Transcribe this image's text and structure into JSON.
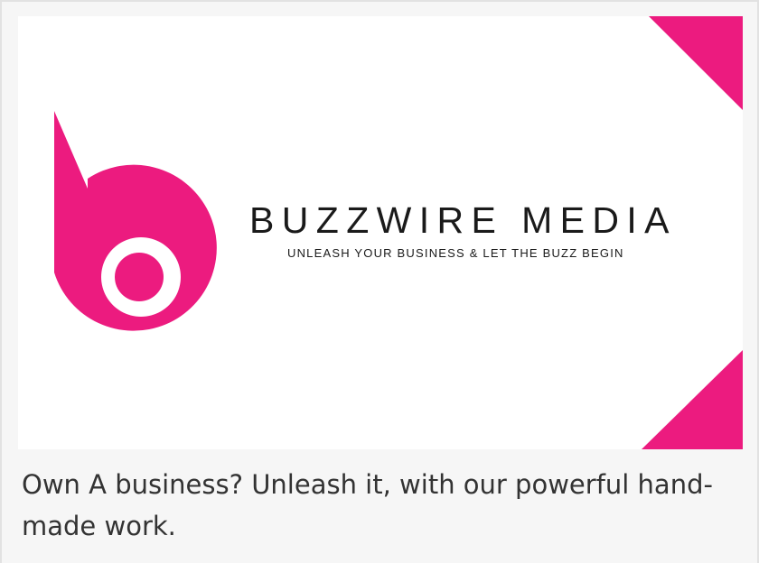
{
  "card": {
    "banner": {
      "brand_name": "BUZZWIRE MEDIA",
      "tagline": "UNLEASH YOUR BUSINESS & LET THE BUZZ BEGIN",
      "logo_letter": "b",
      "accent_color": "#ec1b7f",
      "text_color": "#1a1a1a"
    },
    "caption": "Own A business? Unleash it, with our powerful hand-made work."
  }
}
